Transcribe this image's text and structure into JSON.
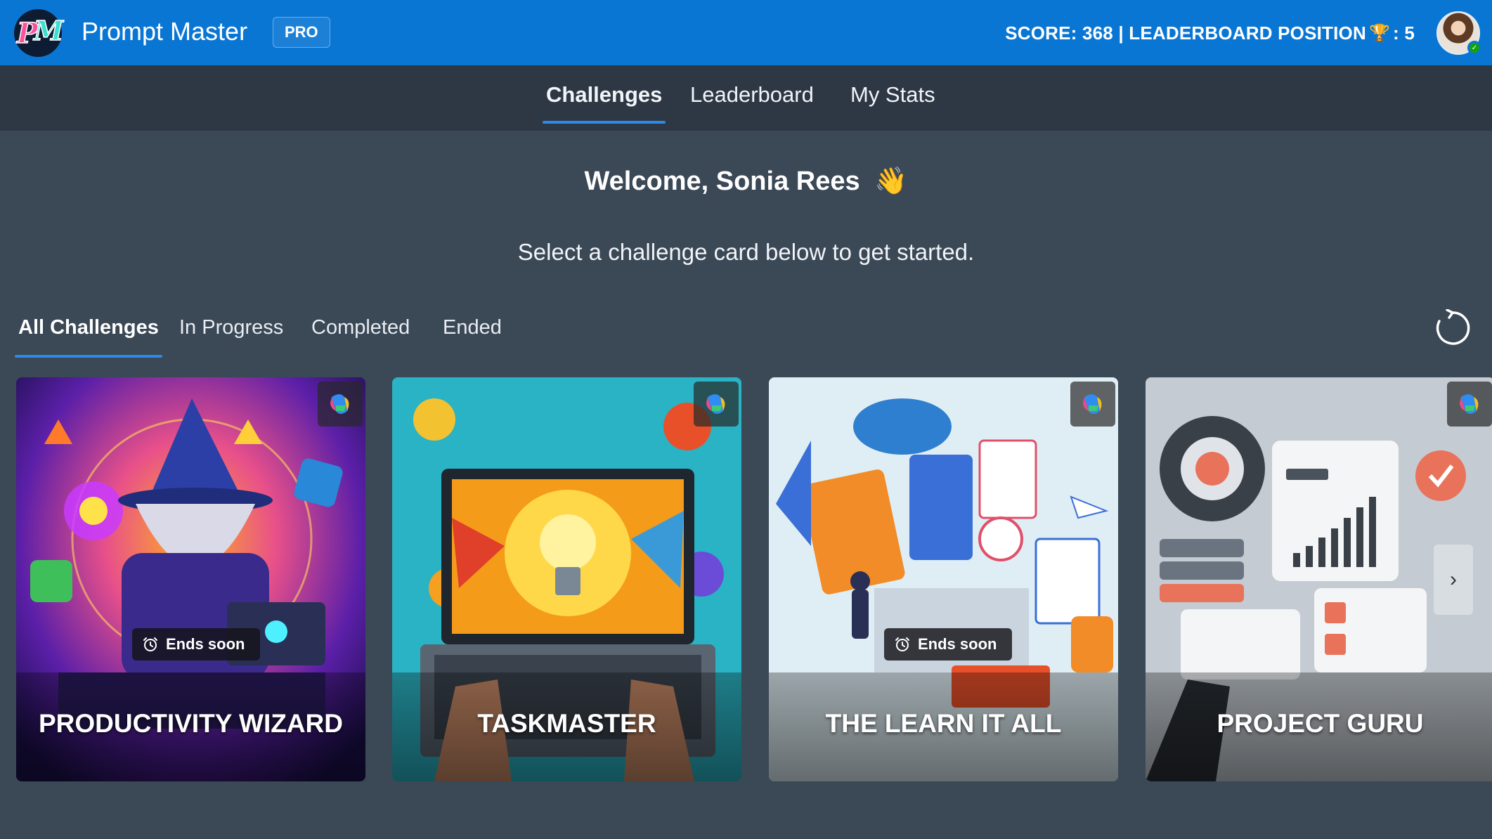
{
  "app": {
    "logo_text": "PM",
    "title": "Prompt Master",
    "badge": "PRO",
    "score_line": "SCORE: 368 | LEADERBOARD POSITION",
    "position_suffix": ": 5",
    "trophy_icon": "trophy-icon"
  },
  "nav": {
    "tabs": [
      {
        "label": "Challenges",
        "active": true
      },
      {
        "label": "Leaderboard",
        "active": false
      },
      {
        "label": "My Stats",
        "active": false
      }
    ]
  },
  "welcome": {
    "heading": "Welcome, Sonia Rees",
    "wave": "👋",
    "subtitle": "Select a challenge card below to get started."
  },
  "filters": {
    "tabs": [
      {
        "label": "All Challenges",
        "active": true
      },
      {
        "label": "In Progress",
        "active": false
      },
      {
        "label": "Completed",
        "active": false
      },
      {
        "label": "Ended",
        "active": false
      }
    ],
    "refresh_icon": "refresh-icon"
  },
  "cards": [
    {
      "title": "PRODUCTIVITY WIZARD",
      "ends_soon": "Ends soon",
      "accent": "#7b2fd1"
    },
    {
      "title": "TASKMASTER",
      "ends_soon": "",
      "accent": "#1aa7b8"
    },
    {
      "title": "THE LEARN IT ALL",
      "ends_soon": "Ends soon",
      "accent": "#f28c28"
    },
    {
      "title": "PROJECT GURU",
      "ends_soon": "",
      "accent": "#e8735a"
    }
  ],
  "colors": {
    "topbar": "#0a76d4",
    "navbar": "#2d3844",
    "background": "#3b4856",
    "tab_underline": "#2b8ae8"
  }
}
